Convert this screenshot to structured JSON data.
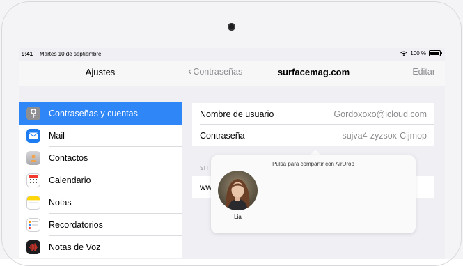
{
  "status_bar": {
    "time": "9:41",
    "date": "Martes 10 de septiembre",
    "battery": "100 %"
  },
  "master": {
    "title": "Ajustes",
    "items": [
      {
        "label": "Contraseñas y cuentas",
        "icon": "key-icon",
        "color": "#8e8e93",
        "selected": true
      },
      {
        "label": "Mail",
        "icon": "mail-icon",
        "color": "#1e7cf2"
      },
      {
        "label": "Contactos",
        "icon": "contacts-icon",
        "color": "#b9b9bd"
      },
      {
        "label": "Calendario",
        "icon": "calendar-icon",
        "color": "#ffffff"
      },
      {
        "label": "Notas",
        "icon": "notes-icon",
        "color": "#ffd60a"
      },
      {
        "label": "Recordatorios",
        "icon": "reminders-icon",
        "color": "#ffffff"
      },
      {
        "label": "Notas de Voz",
        "icon": "voice-memos-icon",
        "color": "#1c1c1e"
      }
    ]
  },
  "detail": {
    "back_label": "Contraseñas",
    "title": "surfacemag.com",
    "edit_label": "Editar",
    "username_key": "Nombre de usuario",
    "username_value": "Gordoxoxo@icloud.com",
    "password_key": "Contraseña",
    "password_value": "sujva4-zyzsox-Cijmop",
    "section_header": "SIT",
    "site_partial": "ww"
  },
  "airdrop": {
    "title": "Pulsa para compartir con AirDrop",
    "contact_name": "Lia"
  },
  "colors": {
    "accent": "#2f86f6",
    "selected_row": "#2f86f6"
  }
}
